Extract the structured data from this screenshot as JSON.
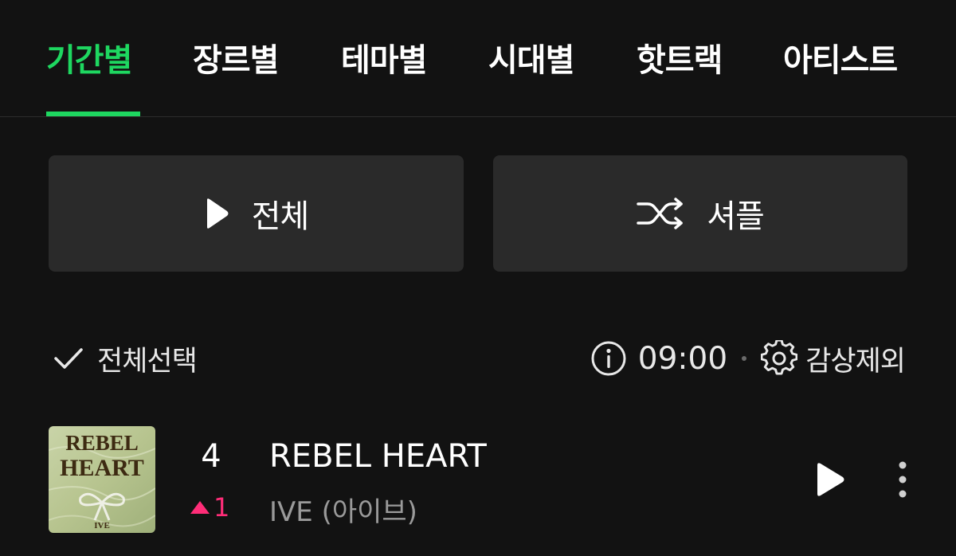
{
  "tabs": [
    {
      "label": "기간별",
      "active": true
    },
    {
      "label": "장르별",
      "active": false
    },
    {
      "label": "테마별",
      "active": false
    },
    {
      "label": "시대별",
      "active": false
    },
    {
      "label": "핫트랙",
      "active": false
    },
    {
      "label": "아티스트",
      "active": false
    }
  ],
  "actions": {
    "play_all_label": "전체",
    "shuffle_label": "셔플"
  },
  "list_header": {
    "select_all_label": "전체선택",
    "update_time": "09:00",
    "exclude_label": "감상제외"
  },
  "tracks": [
    {
      "rank": "4",
      "rank_change": "1",
      "rank_change_direction": "up",
      "title": "REBEL HEART",
      "artist": "IVE (아이브)",
      "cover_text": {
        "line1": "REBEL",
        "line2": "HEART",
        "line3": "IVE"
      }
    }
  ],
  "colors": {
    "accent": "#1ed760",
    "rank_up": "#ff2d78",
    "background": "#121212",
    "button_bg": "#2a2a2a"
  },
  "icons": [
    "play-icon",
    "shuffle-icon",
    "check-icon",
    "info-icon",
    "gear-icon",
    "triangle-up-icon",
    "more-vertical-icon"
  ]
}
